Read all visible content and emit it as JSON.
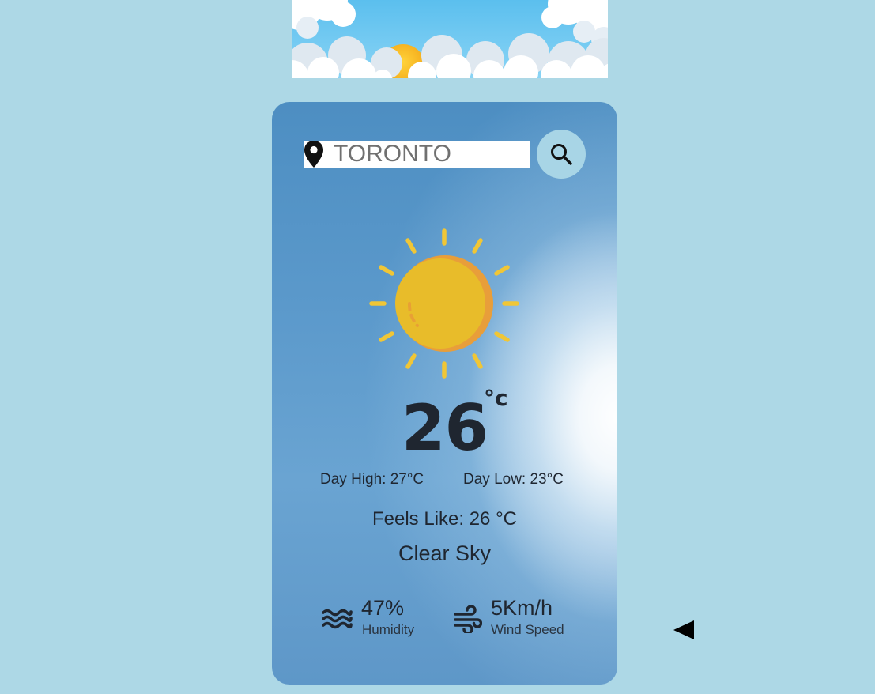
{
  "search": {
    "value": "TORONTO",
    "icon": "search-icon",
    "location_icon": "location-pin-icon"
  },
  "weather": {
    "icon": "sun-icon",
    "temperature": "26",
    "unit": "°c",
    "day_high": "Day High: 27°C",
    "day_low": "Day Low: 23°C",
    "feels_like": "Feels Like: 26 °C",
    "description": "Clear Sky"
  },
  "stats": {
    "humidity": {
      "value": "47%",
      "label": "Humidity",
      "icon": "water-waves-icon"
    },
    "wind": {
      "value": "5Km/h",
      "label": "Wind Speed",
      "icon": "wind-icon"
    }
  },
  "controls": {
    "back_icon": "left-triangle-icon"
  },
  "colors": {
    "page_background": "#add8e6",
    "search_button": "#a8d5e6",
    "sun": "#e8bc2a",
    "sun_shade": "#e89e3a",
    "text": "#1f2630"
  }
}
